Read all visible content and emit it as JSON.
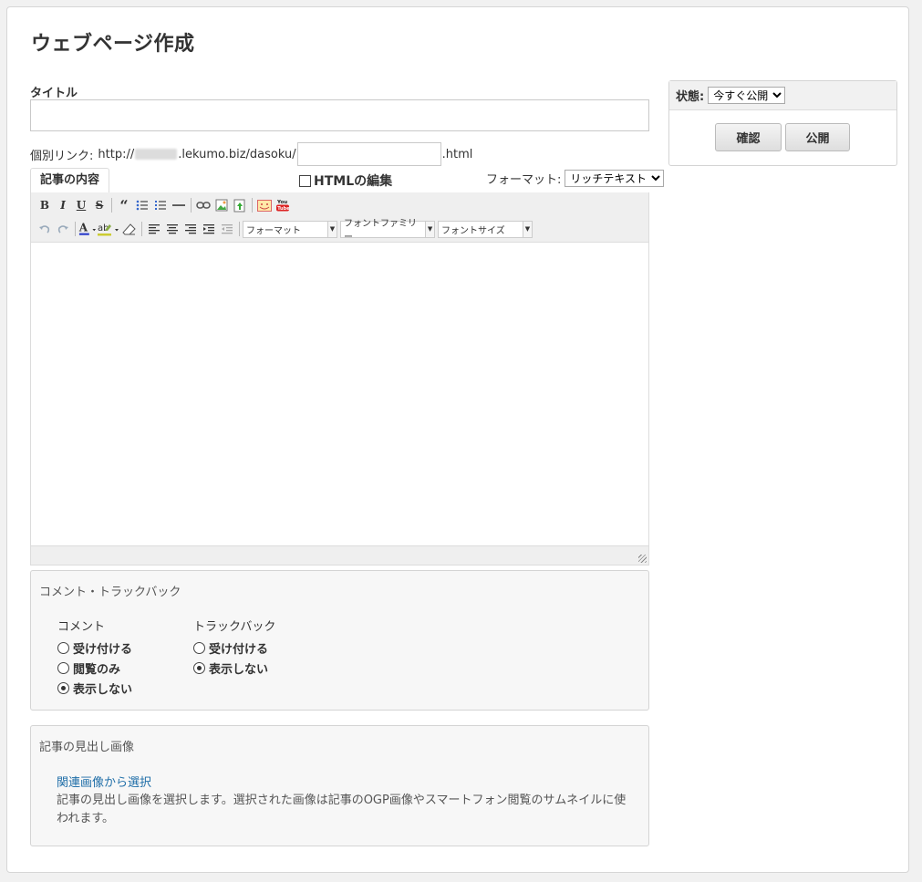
{
  "page": {
    "title": "ウェブページ作成"
  },
  "form": {
    "title_label": "タイトル",
    "title_value": "",
    "permalink_label": "個別リンク:",
    "permalink_prefix": "http://",
    "permalink_domain": ".lekumo.biz/dasoku/",
    "permalink_slug": "",
    "permalink_suffix": ".html"
  },
  "editor": {
    "tab_label": "記事の内容",
    "html_edit_label": "HTMLの編集",
    "html_edit_checked": false,
    "format_label": "フォーマット:",
    "format_value": "リッチテキスト",
    "toolbar_row1": [
      "B",
      "I",
      "U",
      "S",
      "“",
      "☷",
      "☰",
      "—",
      "⊂⊃",
      "▣",
      "⇪",
      "◩",
      "You"
    ],
    "combo_format": "フォーマット",
    "combo_font_family": "フォントファミリー",
    "combo_font_size": "フォントサイズ",
    "body": ""
  },
  "comments": {
    "title": "コメント・トラックバック",
    "comment_heading": "コメント",
    "comment_options": [
      "受け付ける",
      "閲覧のみ",
      "表示しない"
    ],
    "comment_selected": 2,
    "trackback_heading": "トラックバック",
    "trackback_options": [
      "受け付ける",
      "表示しない"
    ],
    "trackback_selected": 1
  },
  "featured_image": {
    "title": "記事の見出し画像",
    "link_text": "関連画像から選択",
    "description": "記事の見出し画像を選択します。選択された画像は記事のOGP画像やスマートフォン閲覧のサムネイルに使われます。"
  },
  "sidebar": {
    "state_label": "状態:",
    "state_value": "今すぐ公開",
    "confirm_label": "確認",
    "publish_label": "公開"
  },
  "colors": {
    "link": "#1f6ea8",
    "panel_bg": "#f7f7f7",
    "toolbar_bg": "#efefef"
  }
}
